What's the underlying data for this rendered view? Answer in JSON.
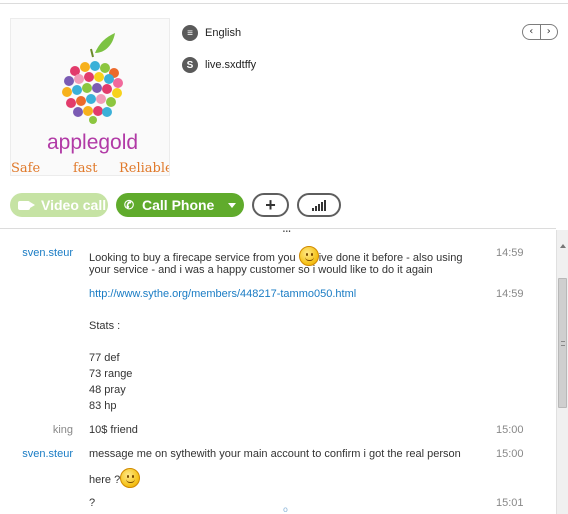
{
  "profile": {
    "brand_text": "applegold",
    "tagline_words": [
      "Safe",
      "fast",
      "Reliable"
    ],
    "language": "English",
    "skype_name": "live.sxdtffy",
    "pager_prev": "‹",
    "pager_next": "›"
  },
  "actions": {
    "video_call_label": "Video call",
    "call_phone_label": "Call Phone",
    "add_label": "+"
  },
  "divider_dots": "...",
  "messages": [
    {
      "sender": "sven.steur",
      "lines_before_emoji": "Looking to buy a firecape service from you ",
      "lines_after_emoji": "ive done it before - also using",
      "line2": "your service - and i was a happy customer so i would like to do it again",
      "time": "14:59"
    },
    {
      "sender": "",
      "link": "http://www.sythe.org/members/448217-tammo050.html",
      "time": "14:59"
    },
    {
      "stats_title": "Stats :",
      "stats": [
        "77 def",
        "73 range",
        "48 pray",
        "83 hp"
      ]
    },
    {
      "sender": "king",
      "text": "10$  friend",
      "time": "15:00"
    },
    {
      "sender": "sven.steur",
      "text": "message me on sythewith your main account to confirm i got the real person",
      "line2": "here  ?",
      "time": "15:00"
    },
    {
      "text": "?",
      "time": "15:01"
    }
  ],
  "colors": {
    "accent_green": "#60ab2c",
    "link_blue": "#1a7cc4",
    "brand_purple": "#b13aa6"
  }
}
